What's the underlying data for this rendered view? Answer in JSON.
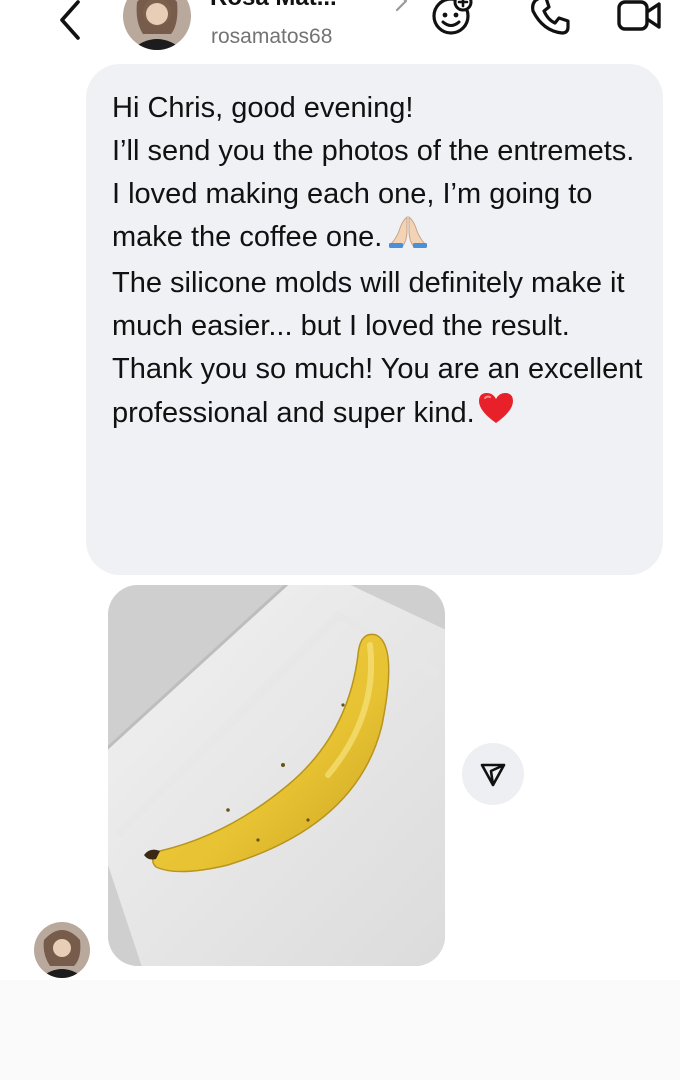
{
  "header": {
    "contact_name": "Rosa Mat...",
    "username": "rosamatos68",
    "icons": {
      "back": "chevron-left-icon",
      "name_chevron": "chevron-right-icon",
      "effects": "face-sparkle-icon",
      "call": "phone-icon",
      "video": "video-camera-icon"
    }
  },
  "message": {
    "paragraphs": [
      "Hi Chris, good evening!",
      "I’ll send you the photos of the entremets.",
      "I loved making each one, I’m going to make the coffee one.",
      "The silicone molds will definitely make it much easier... but I loved the result.",
      "Thank you so much! You are an excellent professional and super kind."
    ],
    "emojis": [
      "folded-hands-icon",
      "red-heart-icon"
    ]
  },
  "photo": {
    "subject": "banana-shaped entremet on white plate"
  },
  "share": {
    "icon": "share-arrow-icon"
  },
  "colors": {
    "bubble_bg": "#eff1f5",
    "text": "#111111",
    "muted": "#737373",
    "heart": "#e8202a"
  }
}
